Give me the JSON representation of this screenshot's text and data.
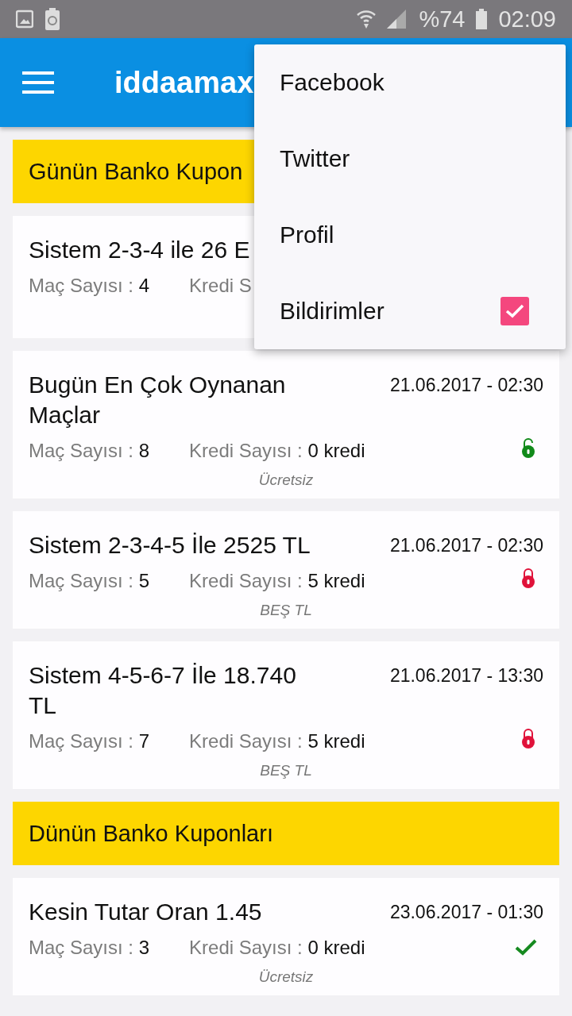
{
  "status_bar": {
    "battery": "%74",
    "time": "02:09"
  },
  "app_bar": {
    "title": "iddaamax"
  },
  "sections": [
    {
      "title": "Günün Banko Kupon",
      "coupons": [
        {
          "title": "Sistem 2-3-4 ile 26 E",
          "matches_label": "Maç Sayısı : ",
          "matches": "4",
          "credit_label": "Kredi S"
        },
        {
          "title": "Bugün En Çok Oynanan Maçlar",
          "date": "21.06.2017 - 02:30",
          "matches_label": "Maç Sayısı : ",
          "matches": "8",
          "credit_label": "Kredi Sayısı : ",
          "credits": "0 kredi",
          "price": "Ücretsiz",
          "kind": "unlocked"
        },
        {
          "title": "Sistem 2-3-4-5 İle 2525 TL",
          "date": "21.06.2017 - 02:30",
          "matches_label": "Maç Sayısı : ",
          "matches": "5",
          "credit_label": "Kredi Sayısı : ",
          "credits": "5 kredi",
          "price": "BEŞ TL",
          "kind": "locked"
        },
        {
          "title": "Sistem 4-5-6-7 İle 18.740 TL",
          "date": "21.06.2017 - 13:30",
          "matches_label": "Maç Sayısı : ",
          "matches": "7",
          "credit_label": "Kredi Sayısı : ",
          "credits": "5 kredi",
          "price": "BEŞ TL",
          "kind": "locked"
        }
      ]
    },
    {
      "title": "Dünün Banko Kuponları",
      "coupons": [
        {
          "title": "Kesin Tutar Oran 1.45",
          "date": "23.06.2017 - 01:30",
          "matches_label": "Maç Sayısı : ",
          "matches": "3",
          "credit_label": "Kredi Sayısı : ",
          "credits": "0 kredi",
          "price": "Ücretsiz",
          "kind": "won"
        }
      ]
    }
  ],
  "menu": [
    {
      "label": "Facebook"
    },
    {
      "label": "Twitter"
    },
    {
      "label": "Profil"
    },
    {
      "label": "Bildirimler",
      "checked": true
    }
  ]
}
